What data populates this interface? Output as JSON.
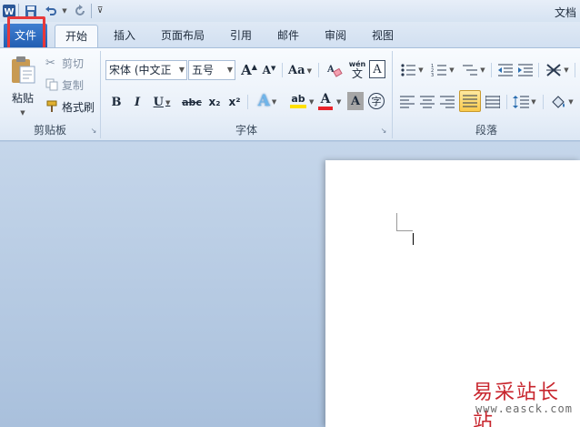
{
  "window": {
    "title": "文档"
  },
  "ribbon": {
    "file_label": "文件",
    "tabs": [
      "开始",
      "插入",
      "页面布局",
      "引用",
      "邮件",
      "审阅",
      "视图"
    ]
  },
  "clipboard": {
    "group_label": "剪贴板",
    "paste": "粘贴",
    "cut": "剪切",
    "copy": "复制",
    "format_painter": "格式刷"
  },
  "font": {
    "group_label": "字体",
    "font_name": "宋体 (中文正",
    "font_size": "五号",
    "grow": "A",
    "shrink": "A",
    "change_case": "Aa",
    "clear_format": "A",
    "phonetic": "wén",
    "phonetic_char": "文",
    "border_char": "A",
    "bold": "B",
    "italic": "I",
    "underline": "U",
    "strike": "abc",
    "subscript": "x₂",
    "superscript": "x²",
    "effects": "A",
    "highlight": "ab",
    "color": "A",
    "shading": "A",
    "enclose": "字"
  },
  "paragraph": {
    "group_label": "段落"
  },
  "colors": {
    "font_color_bar": "#e8222a",
    "highlight_bar": "#ffe000",
    "accent": "#2b5797"
  },
  "watermark": {
    "text": "易采站长站",
    "url": "www.easck.com"
  }
}
